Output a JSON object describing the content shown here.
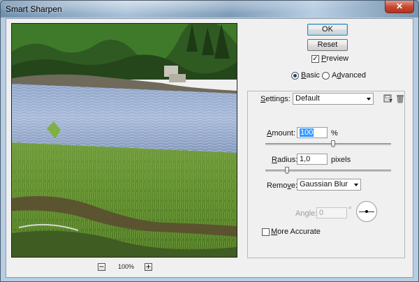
{
  "window": {
    "title": "Smart Sharpen",
    "close_glyph": "✕"
  },
  "preview": {
    "zoom_level": "100%",
    "zoom_out": "−",
    "zoom_in": "+"
  },
  "buttons": {
    "ok": "OK",
    "reset": "Reset"
  },
  "preview_option": {
    "label": "Preview",
    "checked": true
  },
  "mode": {
    "basic": {
      "label": "Basic",
      "selected": true
    },
    "advanced": {
      "label": "Advanced",
      "selected": false
    }
  },
  "settings": {
    "label": "Settings:",
    "value": "Default",
    "save_icon": "save-settings-icon",
    "delete_icon": "trash-icon"
  },
  "amount": {
    "label": "Amount:",
    "value": "100",
    "unit": "%",
    "slider_fraction": 0.5
  },
  "radius": {
    "label": "Radius:",
    "value": "1,0",
    "unit": "pixels",
    "slider_fraction": 0.17
  },
  "remove": {
    "label": "Remove:",
    "value": "Gaussian Blur"
  },
  "angle": {
    "label": "Angle:",
    "value": "0",
    "unit": "°"
  },
  "more_accurate": {
    "label": "More Accurate",
    "checked": false
  },
  "colors": {
    "accent": "#3c7fb1",
    "selection": "#3399ff"
  }
}
